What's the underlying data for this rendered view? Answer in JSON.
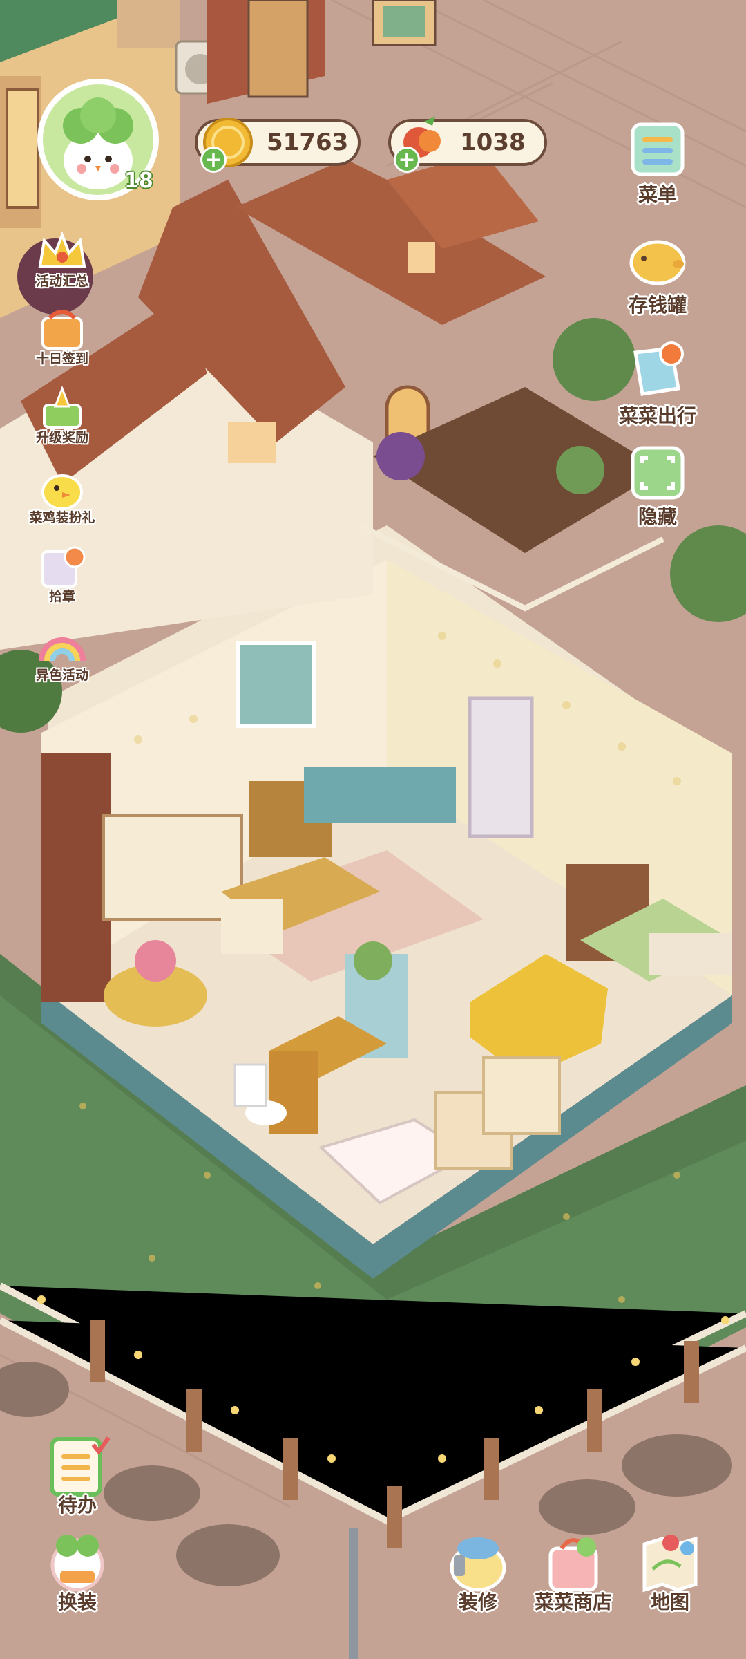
{
  "player": {
    "level": "18"
  },
  "currencies": {
    "coins": {
      "value": "51763",
      "icon": "gold-coin-icon",
      "color": "#f2b935"
    },
    "vegetables": {
      "value": "1038",
      "icon": "carrot-radish-icon",
      "color": "#e0583a"
    }
  },
  "left_menu": [
    {
      "label": "活动汇总",
      "icon": "crown-icon"
    },
    {
      "label": "十日签到",
      "icon": "calendar-basket-icon"
    },
    {
      "label": "升级奖励",
      "icon": "level-up-arrow-icon"
    },
    {
      "label": "菜鸡装扮礼",
      "icon": "yellow-chick-icon"
    },
    {
      "label": "拾章",
      "icon": "badge-collection-icon"
    },
    {
      "label": "异色活动",
      "icon": "rainbow-icon"
    }
  ],
  "right_menu": [
    {
      "label": "菜单",
      "icon": "menu-list-icon"
    },
    {
      "label": "存钱罐",
      "icon": "piggy-bank-icon"
    },
    {
      "label": "菜菜出行",
      "icon": "travel-map-icon"
    },
    {
      "label": "隐藏",
      "icon": "hide-expand-icon"
    }
  ],
  "bottom_bar": {
    "todo": {
      "label": "待办",
      "icon": "todo-clipboard-icon"
    },
    "outfit": {
      "label": "换装",
      "icon": "wardrobe-icon"
    },
    "decorate": {
      "label": "装修",
      "icon": "decorate-hammer-icon"
    },
    "shop": {
      "label": "菜菜商店",
      "icon": "shop-bag-icon"
    },
    "map": {
      "label": "地图",
      "icon": "map-icon"
    }
  },
  "colors": {
    "accent_green": "#67b84f",
    "label_brown": "#5a3c2c",
    "panel_cream": "#fbf3e2"
  }
}
